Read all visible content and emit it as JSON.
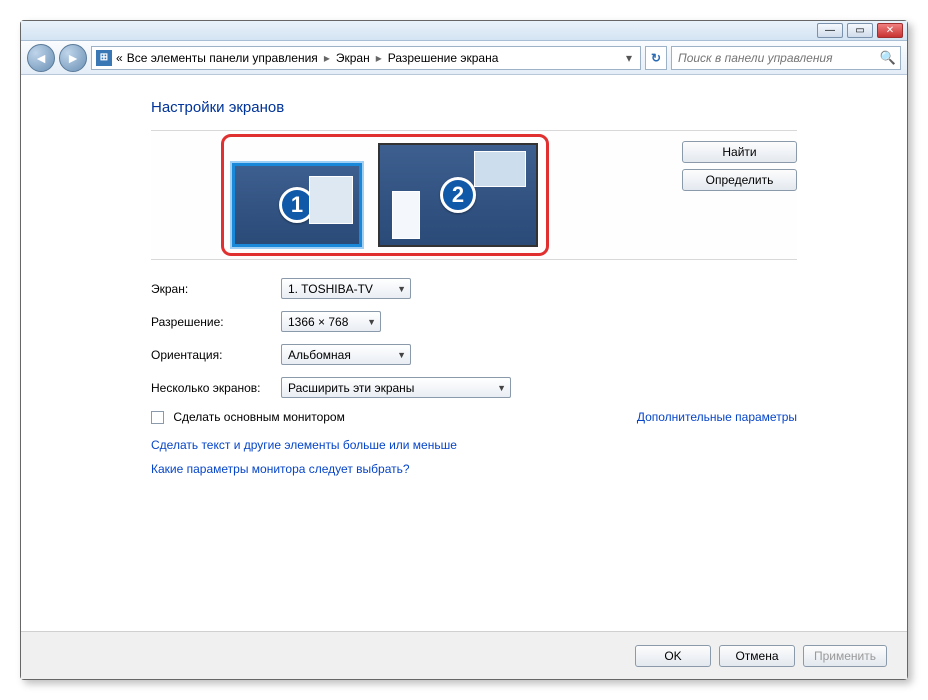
{
  "window": {
    "minimize_glyph": "—",
    "maximize_glyph": "▭",
    "close_glyph": "✕"
  },
  "nav": {
    "back_glyph": "◄",
    "fwd_glyph": "►",
    "crumb_prefix": "«",
    "crumb1": "Все элементы панели управления",
    "crumb2": "Экран",
    "crumb3": "Разрешение экрана",
    "sep_glyph": "▸",
    "drop_glyph": "▾",
    "refresh_glyph": "↻",
    "search_placeholder": "Поиск в панели управления",
    "search_glyph": "🔍"
  },
  "heading": "Настройки экранов",
  "monitors": {
    "primary_num": "1",
    "secondary_num": "2"
  },
  "sidebuttons": {
    "find": "Найти",
    "identify": "Определить"
  },
  "form": {
    "display_label": "Экран:",
    "display_value": "1. TOSHIBA-TV",
    "resolution_label": "Разрешение:",
    "resolution_value": "1366 × 768",
    "orientation_label": "Ориентация:",
    "orientation_value": "Альбомная",
    "multiple_label": "Несколько экранов:",
    "multiple_value": "Расширить эти экраны"
  },
  "checkbox_label": "Сделать основным монитором",
  "advanced_link": "Дополнительные параметры",
  "links": {
    "textsize": "Сделать текст и другие элементы больше или меньше",
    "whichsettings": "Какие параметры монитора следует выбрать?"
  },
  "footer": {
    "ok": "OK",
    "cancel": "Отмена",
    "apply": "Применить"
  },
  "combo_arrow": "▼"
}
